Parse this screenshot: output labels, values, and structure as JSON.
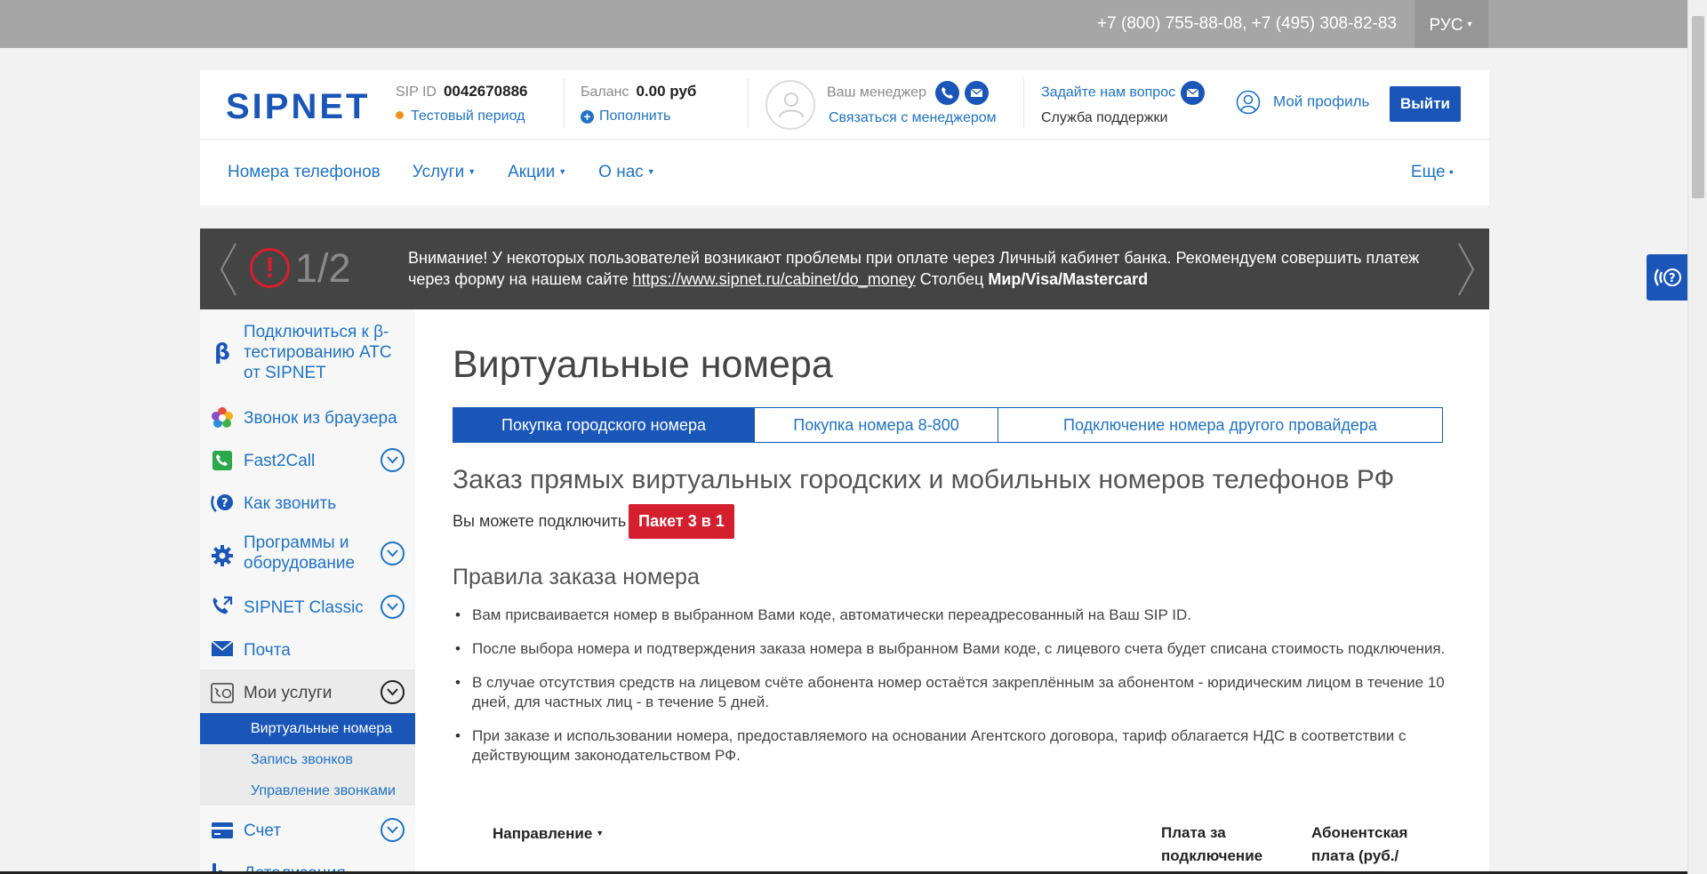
{
  "topbar": {
    "phones": "+7 (800) 755-88-08, +7 (495) 308-82-83",
    "language": "РУС"
  },
  "header": {
    "logo": "SIPNET",
    "sip_label": "SIP ID",
    "sip_id": "0042670886",
    "trial": "Тестовый период",
    "balance_label": "Баланс",
    "balance_value": "0.00 руб",
    "topup": "Пополнить",
    "manager_label": "Ваш менеджер",
    "contact_manager": "Связаться с менеджером",
    "ask_question": "Задайте нам вопрос",
    "support": "Служба поддержки",
    "profile": "Мой профиль",
    "logout": "Выйти"
  },
  "nav": {
    "items": [
      "Номера телефонов",
      "Услуги",
      "Акции",
      "О нас"
    ],
    "more": "Еще"
  },
  "banner": {
    "counter": "1/2",
    "text_before_link": "Внимание! У некоторых пользователей возникают проблемы при оплате через Личный кабинет банка. Рекомендуем совершить платеж через форму на нашем сайте",
    "link": "https://www.sipnet.ru/cabinet/do_money",
    "text_after_link": "Столбец",
    "bold_tail": "Мир/Visa/Mastercard"
  },
  "sidebar": {
    "items": [
      "Подключиться к β-тестированию АТС от SIPNET",
      "Звонок из браузера",
      "Fast2Call",
      "Как звонить",
      "Программы и оборудование",
      "SIPNET Classic",
      "Почта",
      "Мои услуги",
      "Счет",
      "Детализация"
    ],
    "sub_items": [
      "Виртуальные номера",
      "Запись звонков",
      "Управление звонками"
    ]
  },
  "main": {
    "title": "Виртуальные номера",
    "tabs": [
      "Покупка городского номера",
      "Покупка номера 8-800",
      "Подключение номера другого провайдера"
    ],
    "subtitle": "Заказ прямых виртуальных городских и мобильных номеров телефонов РФ",
    "connect_text": "Вы можете подключить",
    "package_button": "Пакет 3 в 1",
    "rules_title": "Правила заказа номера",
    "rules": [
      "Вам присваивается номер в выбранном Вами коде, автоматически переадресованный на Ваш SIP ID.",
      "После выбора номера и подтверждения заказа номера в выбранном Вами коде, с лицевого счета будет списана стоимость подключения.",
      "В случае отсутствия средств на лицевом счёте абонента номер остаётся закреплённым за абонентом - юридическим лицом в течение 10 дней, для частных лиц - в течение 5 дней.",
      "При заказе и использовании номера, предоставляемого на основании Агентского договора, тариф облагается НДС в соответствии с действующим законодательством РФ."
    ],
    "table_headers": {
      "direction": "Направление",
      "connection_fee": "Плата за подключение",
      "subscription_fee": "Абонентская плата (руб./"
    }
  },
  "colors": {
    "brand": "#1a56b8",
    "link": "#1f73c6",
    "accent_red": "#d41f2e",
    "trial_dot": "#f29320"
  }
}
